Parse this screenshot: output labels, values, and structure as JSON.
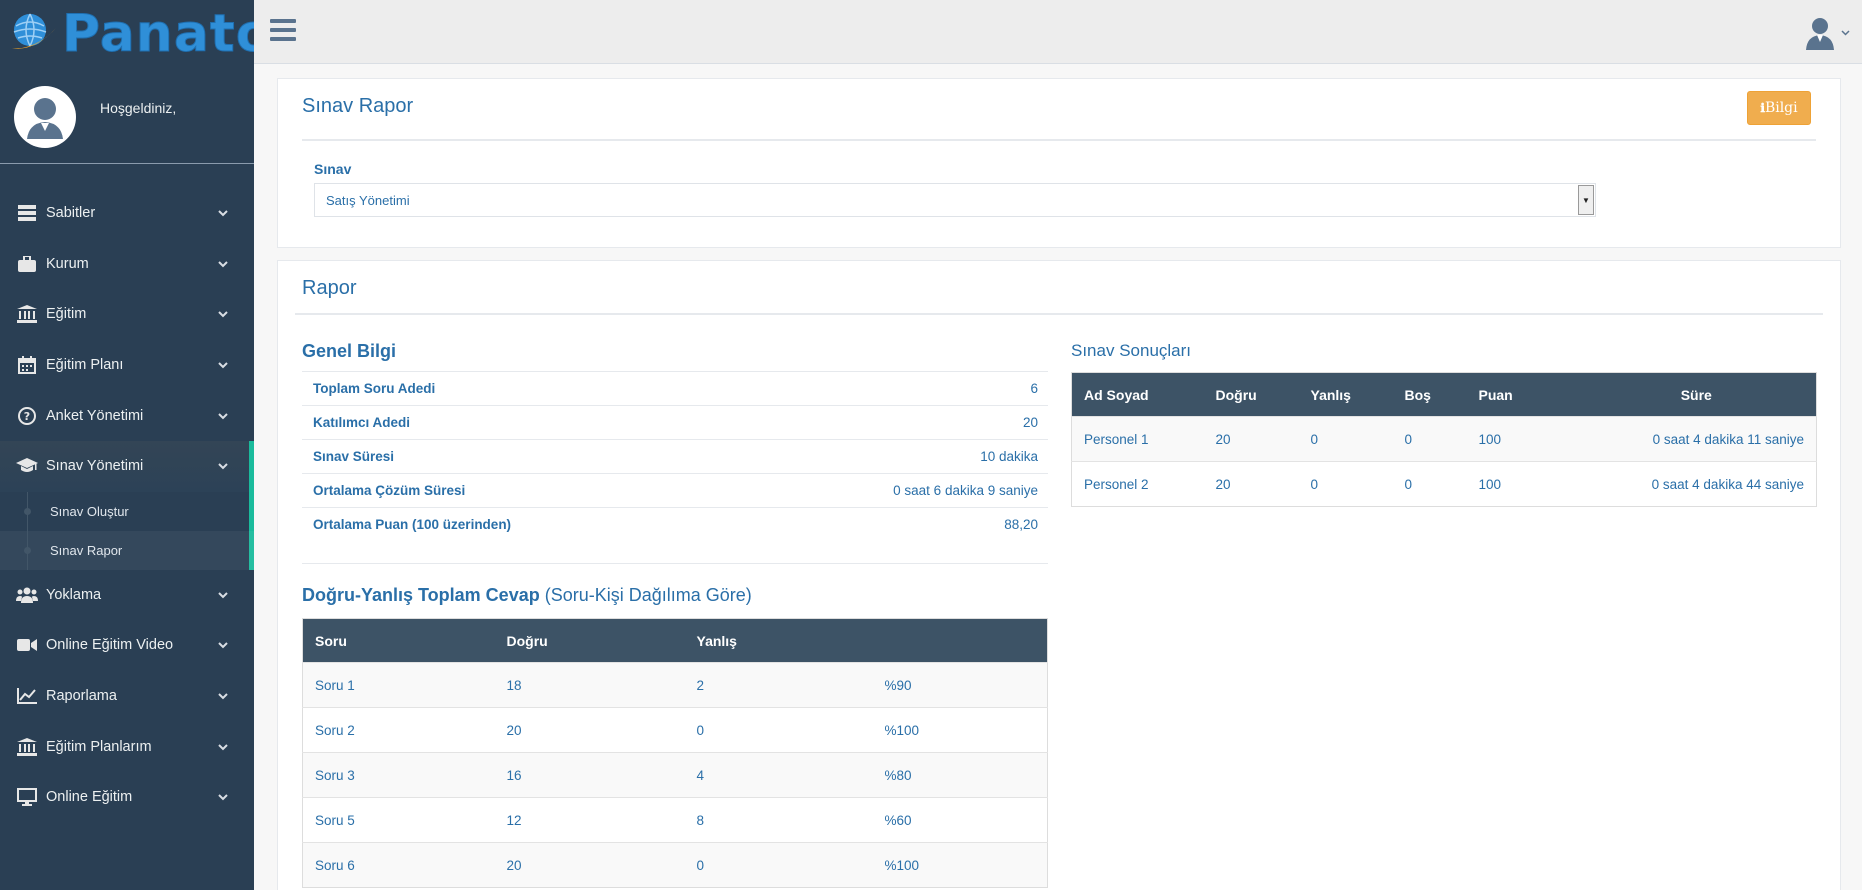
{
  "brand": {
    "logo_text": "Panato"
  },
  "sidebar": {
    "welcome": "Hoşgeldiniz,",
    "items": [
      {
        "label": "Sabitler",
        "icon": "server-icon"
      },
      {
        "label": "Kurum",
        "icon": "briefcase-icon"
      },
      {
        "label": "Eğitim",
        "icon": "institution-icon"
      },
      {
        "label": "Eğitim Planı",
        "icon": "calendar-icon"
      },
      {
        "label": "Anket Yönetimi",
        "icon": "question-circle-icon"
      },
      {
        "label": "Sınav Yönetimi",
        "icon": "graduation-cap-icon"
      },
      {
        "label": "Yoklama",
        "icon": "users-icon"
      },
      {
        "label": "Online Eğitim Video",
        "icon": "video-camera-icon"
      },
      {
        "label": "Raporlama",
        "icon": "line-chart-icon"
      },
      {
        "label": "Eğitim Planlarım",
        "icon": "institution-icon"
      },
      {
        "label": "Online Eğitim",
        "icon": "desktop-icon"
      }
    ],
    "submenu": [
      {
        "label": "Sınav Oluştur"
      },
      {
        "label": "Sınav Rapor"
      }
    ]
  },
  "exam_panel": {
    "title": "Sınav Rapor",
    "info_button": "Bilgi",
    "field_label": "Sınav",
    "selected_exam": "Satış Yönetimi"
  },
  "report_panel": {
    "title": "Rapor",
    "general": {
      "heading": "Genel Bilgi",
      "rows": [
        {
          "label": "Toplam Soru Adedi",
          "value": "6"
        },
        {
          "label": "Katılımcı Adedi",
          "value": "20"
        },
        {
          "label": "Sınav Süresi",
          "value": "10 dakika"
        },
        {
          "label": "Ortalama Çözüm Süresi",
          "value": "0 saat 6 dakika 9 saniye"
        },
        {
          "label": "Ortalama Puan (100 üzerinden)",
          "value": "88,20"
        }
      ]
    },
    "distribution": {
      "heading_bold": "Doğru-Yanlış Toplam Cevap",
      "heading_rest": " (Soru-Kişi Dağılıma Göre)",
      "columns": [
        "Soru",
        "Doğru",
        "Yanlış",
        ""
      ],
      "rows": [
        [
          "Soru 1",
          "18",
          "2",
          "%90"
        ],
        [
          "Soru 2",
          "20",
          "0",
          "%100"
        ],
        [
          "Soru 3",
          "16",
          "4",
          "%80"
        ],
        [
          "Soru 5",
          "12",
          "8",
          "%60"
        ],
        [
          "Soru 6",
          "20",
          "0",
          "%100"
        ]
      ]
    },
    "results": {
      "heading": "Sınav Sonuçları",
      "columns": [
        "Ad Soyad",
        "Doğru",
        "Yanlış",
        "Boş",
        "Puan",
        "Süre"
      ],
      "rows": [
        [
          "Personel 1",
          "20",
          "0",
          "0",
          "100",
          "0 saat 4 dakika 11 saniye"
        ],
        [
          "Personel 2",
          "20",
          "0",
          "0",
          "100",
          "0 saat 4 dakika 44 saniye"
        ]
      ]
    }
  }
}
